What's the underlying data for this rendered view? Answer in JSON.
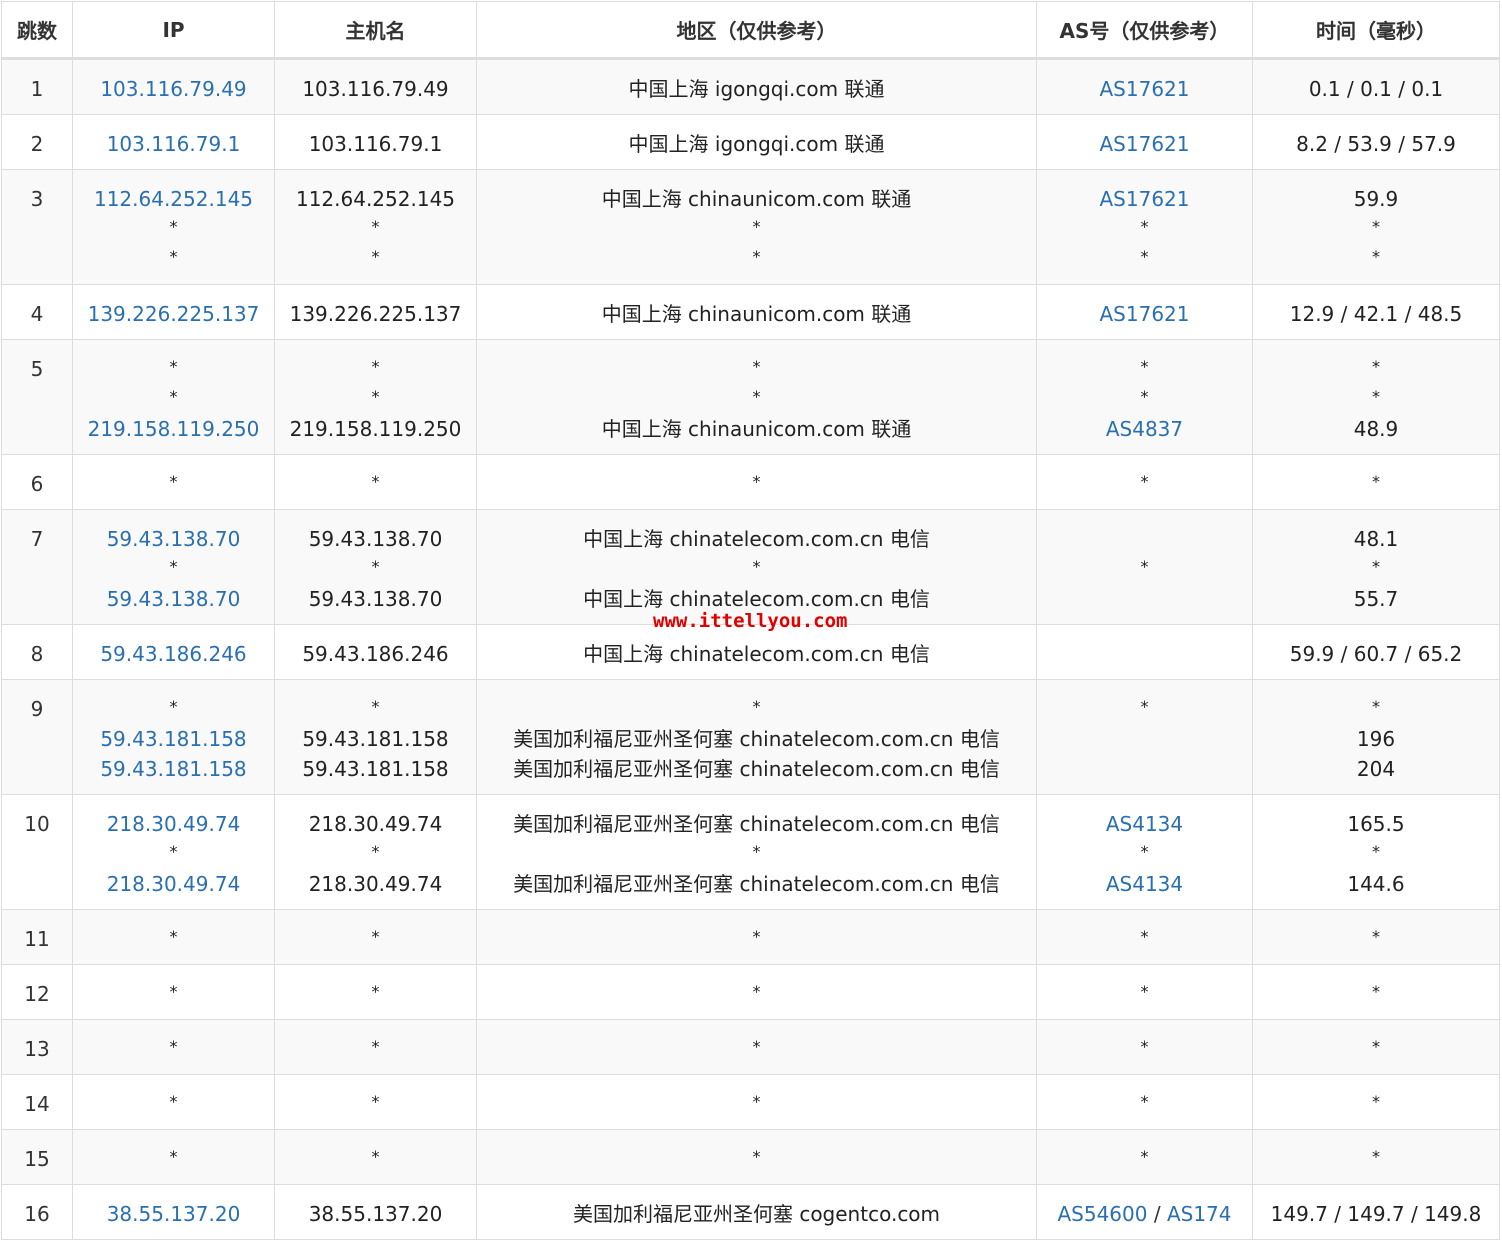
{
  "headers": {
    "hop": "跳数",
    "ip": "IP",
    "hostname": "主机名",
    "region": "地区（仅供参考）",
    "as": "AS号（仅供参考）",
    "time": "时间（毫秒）"
  },
  "colors": {
    "link": "#2a6fb0",
    "watermark": "#e00000",
    "stripe": "#f9f9f9",
    "border": "#dddddd"
  },
  "watermark": "www.ittellyou.com",
  "rows": [
    {
      "hop": "1",
      "ip": [
        "103.116.79.49"
      ],
      "host": [
        "103.116.79.49"
      ],
      "region": [
        "中国上海 igongqi.com 联通"
      ],
      "as": [
        [
          "AS17621"
        ]
      ],
      "time": [
        "0.1 / 0.1 / 0.1"
      ]
    },
    {
      "hop": "2",
      "ip": [
        "103.116.79.1"
      ],
      "host": [
        "103.116.79.1"
      ],
      "region": [
        "中国上海 igongqi.com 联通"
      ],
      "as": [
        [
          "AS17621"
        ]
      ],
      "time": [
        "8.2 / 53.9 / 57.9"
      ]
    },
    {
      "hop": "3",
      "ip": [
        "112.64.252.145",
        "*",
        "*"
      ],
      "host": [
        "112.64.252.145",
        "*",
        "*"
      ],
      "region": [
        "中国上海 chinaunicom.com 联通",
        "*",
        "*"
      ],
      "as": [
        [
          "AS17621"
        ],
        "*",
        "*"
      ],
      "time": [
        "59.9",
        "*",
        "*"
      ]
    },
    {
      "hop": "4",
      "ip": [
        "139.226.225.137"
      ],
      "host": [
        "139.226.225.137"
      ],
      "region": [
        "中国上海 chinaunicom.com 联通"
      ],
      "as": [
        [
          "AS17621"
        ]
      ],
      "time": [
        "12.9 / 42.1 / 48.5"
      ]
    },
    {
      "hop": "5",
      "ip": [
        "*",
        "*",
        "219.158.119.250"
      ],
      "host": [
        "*",
        "*",
        "219.158.119.250"
      ],
      "region": [
        "*",
        "*",
        "中国上海 chinaunicom.com 联通"
      ],
      "as": [
        "*",
        "*",
        [
          "AS4837"
        ]
      ],
      "time": [
        "*",
        "*",
        "48.9"
      ]
    },
    {
      "hop": "6",
      "ip": [
        "*"
      ],
      "host": [
        "*"
      ],
      "region": [
        "*"
      ],
      "as": [
        "*"
      ],
      "time": [
        "*"
      ]
    },
    {
      "hop": "7",
      "ip": [
        "59.43.138.70",
        "*",
        "59.43.138.70"
      ],
      "host": [
        "59.43.138.70",
        "*",
        "59.43.138.70"
      ],
      "region": [
        "中国上海 chinatelecom.com.cn 电信",
        "*",
        "中国上海 chinatelecom.com.cn 电信"
      ],
      "as": [
        "",
        "*",
        ""
      ],
      "time": [
        "48.1",
        "*",
        "55.7"
      ]
    },
    {
      "hop": "8",
      "ip": [
        "59.43.186.246"
      ],
      "host": [
        "59.43.186.246"
      ],
      "region": [
        "中国上海 chinatelecom.com.cn 电信"
      ],
      "as": [
        ""
      ],
      "time": [
        "59.9 / 60.7 / 65.2"
      ]
    },
    {
      "hop": "9",
      "ip": [
        "*",
        "59.43.181.158",
        "59.43.181.158"
      ],
      "host": [
        "*",
        "59.43.181.158",
        "59.43.181.158"
      ],
      "region": [
        "*",
        "美国加利福尼亚州圣何塞 chinatelecom.com.cn 电信",
        "美国加利福尼亚州圣何塞 chinatelecom.com.cn 电信"
      ],
      "as": [
        "*",
        "",
        ""
      ],
      "time": [
        "*",
        "196",
        "204"
      ]
    },
    {
      "hop": "10",
      "ip": [
        "218.30.49.74",
        "*",
        "218.30.49.74"
      ],
      "host": [
        "218.30.49.74",
        "*",
        "218.30.49.74"
      ],
      "region": [
        "美国加利福尼亚州圣何塞 chinatelecom.com.cn 电信",
        "*",
        "美国加利福尼亚州圣何塞 chinatelecom.com.cn 电信"
      ],
      "as": [
        [
          "AS4134"
        ],
        "*",
        [
          "AS4134"
        ]
      ],
      "time": [
        "165.5",
        "*",
        "144.6"
      ]
    },
    {
      "hop": "11",
      "ip": [
        "*"
      ],
      "host": [
        "*"
      ],
      "region": [
        "*"
      ],
      "as": [
        "*"
      ],
      "time": [
        "*"
      ]
    },
    {
      "hop": "12",
      "ip": [
        "*"
      ],
      "host": [
        "*"
      ],
      "region": [
        "*"
      ],
      "as": [
        "*"
      ],
      "time": [
        "*"
      ]
    },
    {
      "hop": "13",
      "ip": [
        "*"
      ],
      "host": [
        "*"
      ],
      "region": [
        "*"
      ],
      "as": [
        "*"
      ],
      "time": [
        "*"
      ]
    },
    {
      "hop": "14",
      "ip": [
        "*"
      ],
      "host": [
        "*"
      ],
      "region": [
        "*"
      ],
      "as": [
        "*"
      ],
      "time": [
        "*"
      ]
    },
    {
      "hop": "15",
      "ip": [
        "*"
      ],
      "host": [
        "*"
      ],
      "region": [
        "*"
      ],
      "as": [
        "*"
      ],
      "time": [
        "*"
      ]
    },
    {
      "hop": "16",
      "ip": [
        "38.55.137.20"
      ],
      "host": [
        "38.55.137.20"
      ],
      "region": [
        "美国加利福尼亚州圣何塞 cogentco.com"
      ],
      "as": [
        [
          "AS54600",
          "AS174"
        ]
      ],
      "time": [
        "149.7 / 149.7 / 149.8"
      ]
    }
  ]
}
